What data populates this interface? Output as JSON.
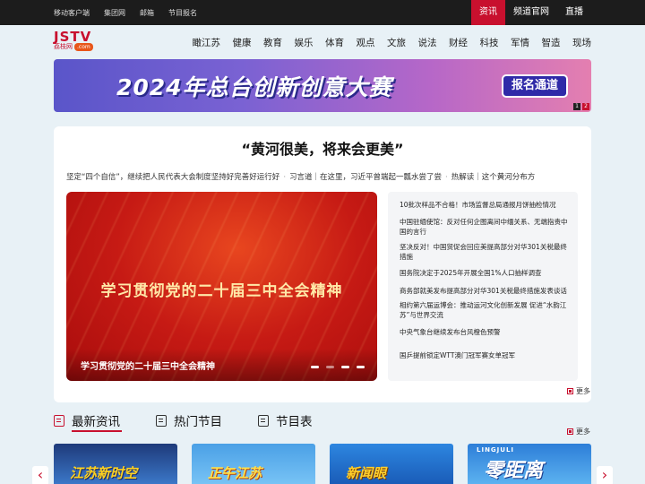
{
  "topbar": {
    "left_links": [
      "移动客户端",
      "集团网",
      "邮箱",
      "节目报名"
    ],
    "right_links": [
      {
        "label": "资讯",
        "active": true
      },
      {
        "label": "频道官网",
        "active": false
      },
      {
        "label": "直播",
        "active": false
      }
    ]
  },
  "logo": {
    "main": "JSTV",
    "sub": "荔枝网",
    "badge": ".com"
  },
  "nav": [
    "瞰江苏",
    "健康",
    "教育",
    "娱乐",
    "体育",
    "观点",
    "文旅",
    "说法",
    "财经",
    "科技",
    "军情",
    "智造",
    "现场"
  ],
  "banner": {
    "title": "2024年总台创新创意大赛",
    "button": "报名通道",
    "page_1": "1",
    "page_2": "2",
    "gradient": [
      "#5a55c9",
      "#e47fb0"
    ]
  },
  "main": {
    "headline": "“黄河很美，将来会更美”",
    "sublinks": [
      "坚定“四个自信”，继续把人民代表大会制度坚持好完善好运行好",
      "习言道｜在这里，习近平曾端起一瓢水尝了尝",
      "热解读｜这个黄河分布方"
    ],
    "slide": {
      "image_text": "学习贯彻党的二十届三中全会精神",
      "caption": "学习贯彻党的二十届三中全会精神",
      "dot_count": 4,
      "active_dot": 1
    },
    "news": [
      "10批次样品不合格！市场监督总局通报月饼抽检情况",
      "中国驻缅使馆：反对任何企图离间中缅关系、无端指责中国的言行",
      "坚决反对！中国贸促会回应美提高部分对华301关税最终措施",
      "国务院决定于2025年开展全国1%人口抽样调查",
      "商务部就美发布提高部分对华301关税最终措施发表谈话",
      "相约第六届运博会：推动运河文化创新发展 促进“水韵江苏”与世界交流",
      "中央气象台继续发布台风橙色预警",
      "国乒提前锁定WTT澳门冠军赛女单冠军"
    ],
    "more": "更多"
  },
  "tabs": [
    {
      "label": "最新资讯",
      "active": true
    },
    {
      "label": "热门节目",
      "active": false
    },
    {
      "label": "节目表",
      "active": false
    }
  ],
  "tabs_more": "更多",
  "thumbnails": [
    {
      "title": "江苏新时空"
    },
    {
      "title": "正午江苏"
    },
    {
      "title": "新闻眼"
    },
    {
      "title": "零距离",
      "subtitle": "LINGJULI"
    }
  ],
  "arrows": {
    "left": "‹",
    "right": "›"
  },
  "colors": {
    "accent": "#c8102e",
    "topbar": "#1c1c1c",
    "page_bg": "#e8f1f6"
  }
}
